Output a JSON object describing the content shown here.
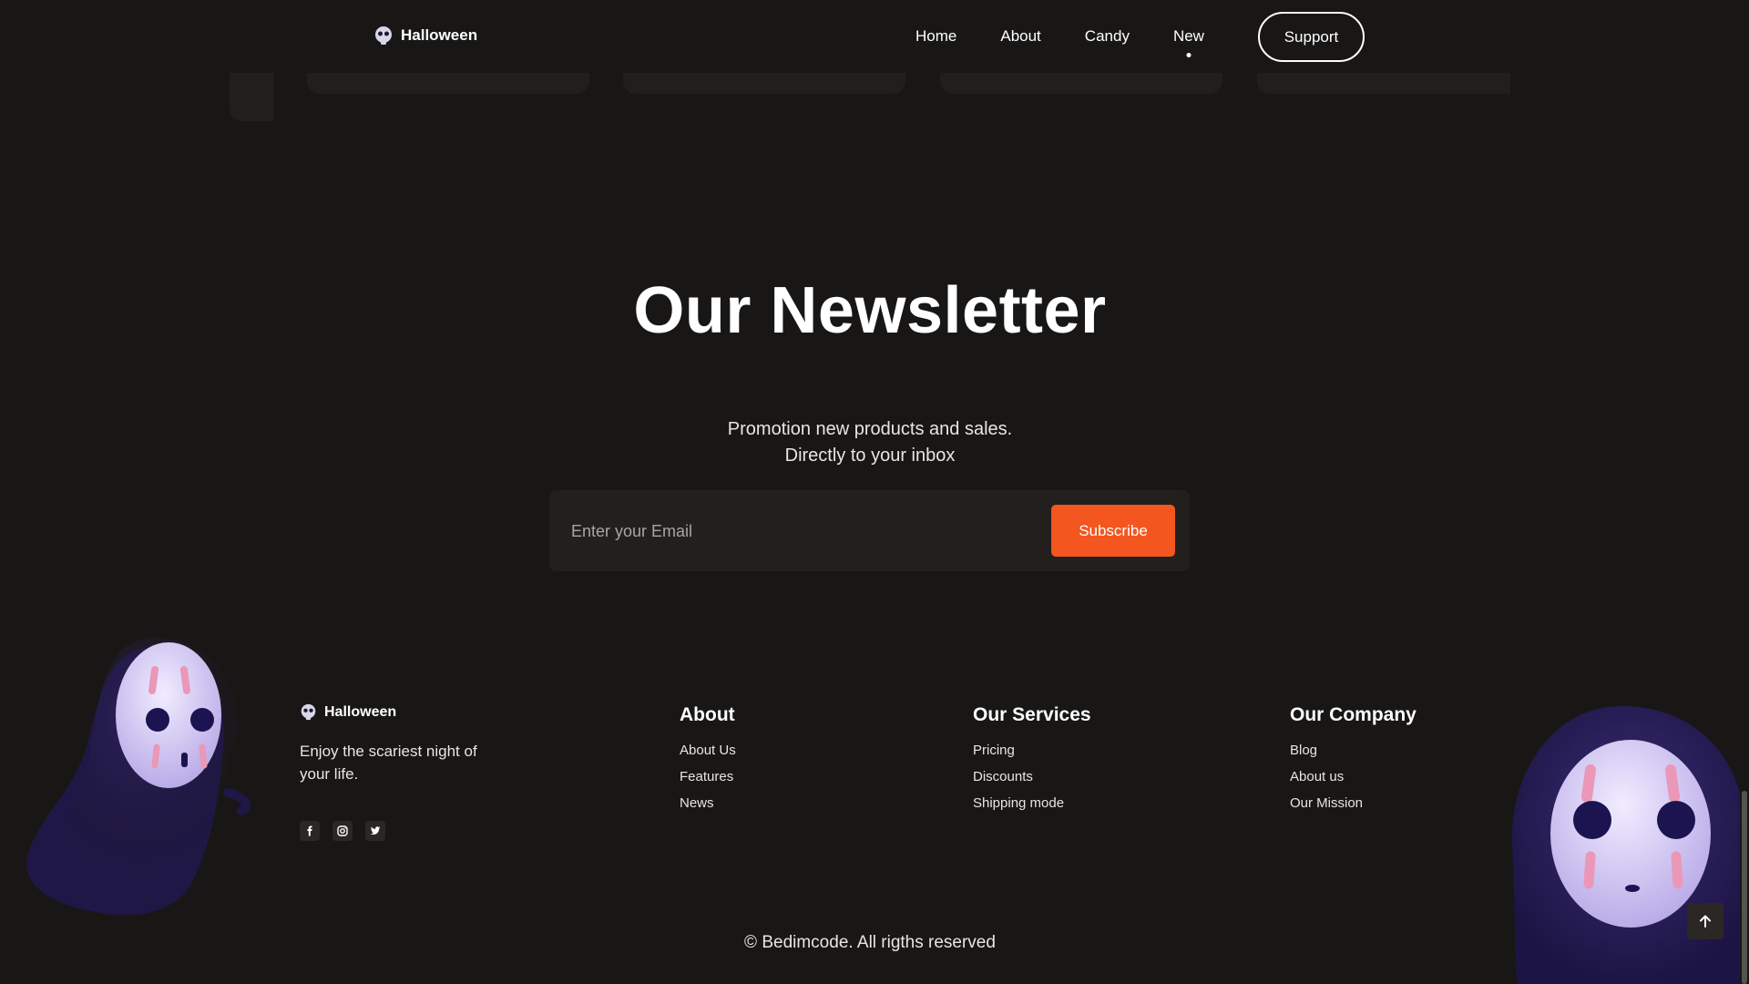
{
  "header": {
    "brand": "Halloween",
    "nav": [
      {
        "label": "Home"
      },
      {
        "label": "About"
      },
      {
        "label": "Candy"
      },
      {
        "label": "New",
        "active": true
      }
    ],
    "support_label": "Support"
  },
  "newsletter": {
    "title": "Our Newsletter",
    "desc_line1": "Promotion new products and sales.",
    "desc_line2": "Directly to your inbox",
    "email_placeholder": "Enter your Email",
    "subscribe_label": "Subscribe"
  },
  "footer": {
    "brand": "Halloween",
    "tagline": "Enjoy the scariest night of your life.",
    "socials": [
      "facebook-icon",
      "instagram-icon",
      "twitter-icon"
    ],
    "columns": [
      {
        "title": "About",
        "links": [
          "About Us",
          "Features",
          "News"
        ]
      },
      {
        "title": "Our Services",
        "links": [
          "Pricing",
          "Discounts",
          "Shipping mode"
        ]
      },
      {
        "title": "Our Company",
        "links": [
          "Blog",
          "About us",
          "Our Mission"
        ]
      }
    ],
    "copyright": "© Bedimcode. All rigths reserved"
  },
  "colors": {
    "background": "#181716",
    "accent": "#f3561f",
    "form_bg": "#221f1d"
  }
}
